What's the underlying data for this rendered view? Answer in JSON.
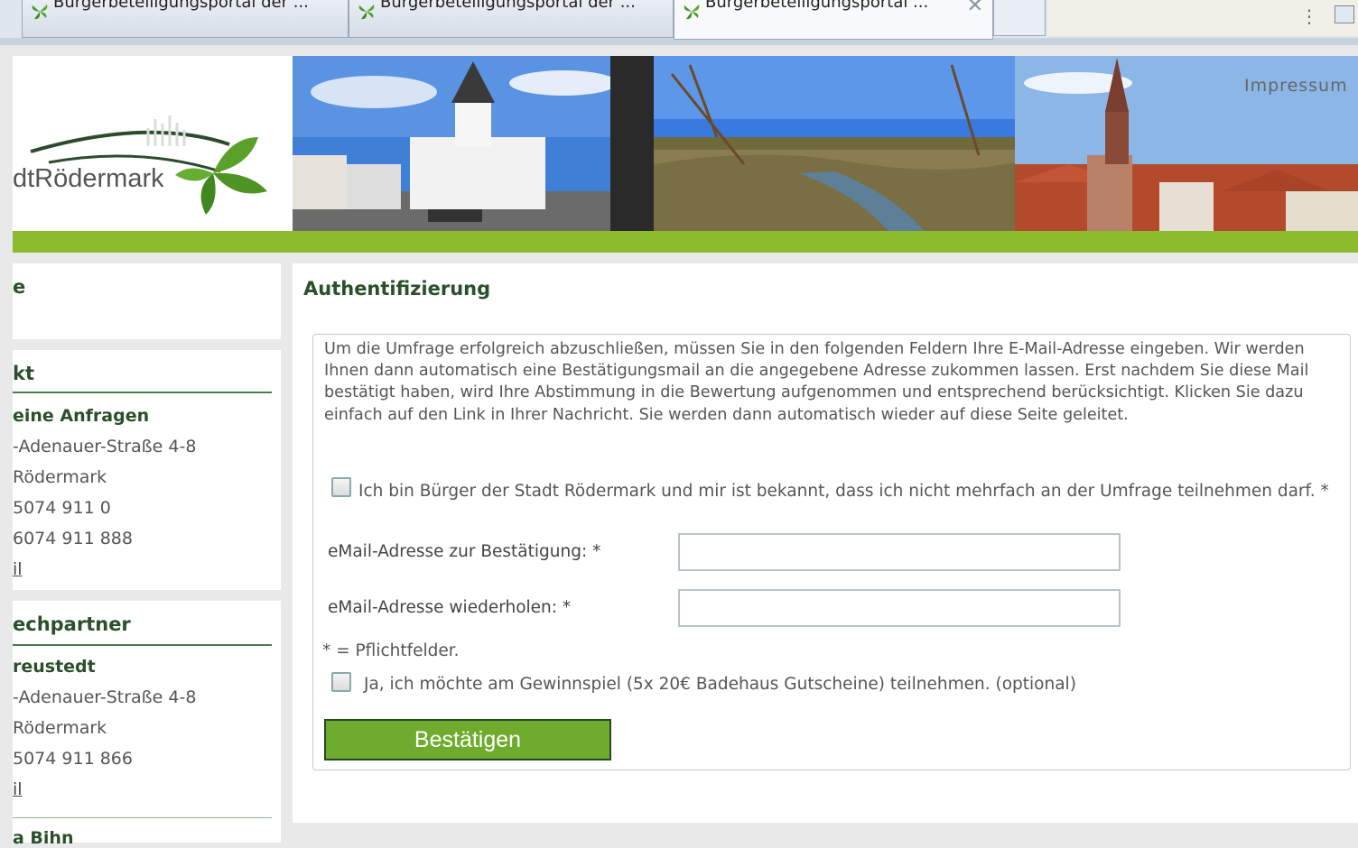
{
  "browser": {
    "tabs": [
      {
        "label": "Bürgerbeteiligungsportal der ..."
      },
      {
        "label": "Bürgerbeteiligungsportal der ..."
      },
      {
        "label": "Bürgerbeteiligungsportal ..."
      }
    ],
    "menu_dots": "⋮"
  },
  "header": {
    "logo_text": "dtRödermark",
    "impressum": "Impressum"
  },
  "sidebar": {
    "box1": {
      "heading": "e"
    },
    "kontakt": {
      "heading": "kt",
      "lines": [
        "eine Anfragen",
        "-Adenauer-Straße 4-8",
        "Rödermark",
        "5074 911 0",
        "6074 911 888",
        "il"
      ]
    },
    "ansprechpartner": {
      "heading": "echpartner",
      "lines": [
        "reustedt",
        "-Adenauer-Straße 4-8",
        "Rödermark",
        "5074 911 866",
        "il"
      ],
      "next_name": "a Bihn"
    }
  },
  "main": {
    "title": "Authentifizierung",
    "intro": "Um die Umfrage erfolgreich abzuschließen, müssen Sie in den folgenden Feldern Ihre E-Mail-Adresse eingeben. Wir werden Ihnen dann automatisch eine Bestätigungsmail an die angegebene Adresse zukommen lassen. Erst nachdem Sie diese Mail bestätigt haben, wird Ihre Abstimmung in die Bewertung aufgenommen und entsprechend berücksichtigt. Klicken Sie dazu einfach auf den Link in Ihrer Nachricht. Sie werden dann automatisch wieder auf diese Seite geleitet.",
    "citizen_checkbox_label": "Ich bin Bürger der Stadt Rödermark und mir ist bekannt, dass ich nicht mehrfach an der Umfrage teilnehmen darf. *",
    "email_label": "eMail-Adresse zur Bestätigung: *",
    "email_value": "",
    "email_repeat_label": "eMail-Adresse wiederholen: *",
    "email_repeat_value": "",
    "required_note": "* = Pflichtfelder.",
    "raffle_checkbox_label": "Ja, ich möchte am Gewinnspiel (5x 20€ Badehaus Gutscheine) teilnehmen. (optional)",
    "submit_label": "Bestätigen"
  },
  "colors": {
    "accent_green": "#8dbb2e",
    "button_green": "#6fab2c",
    "heading_green": "#2b4f2b"
  }
}
